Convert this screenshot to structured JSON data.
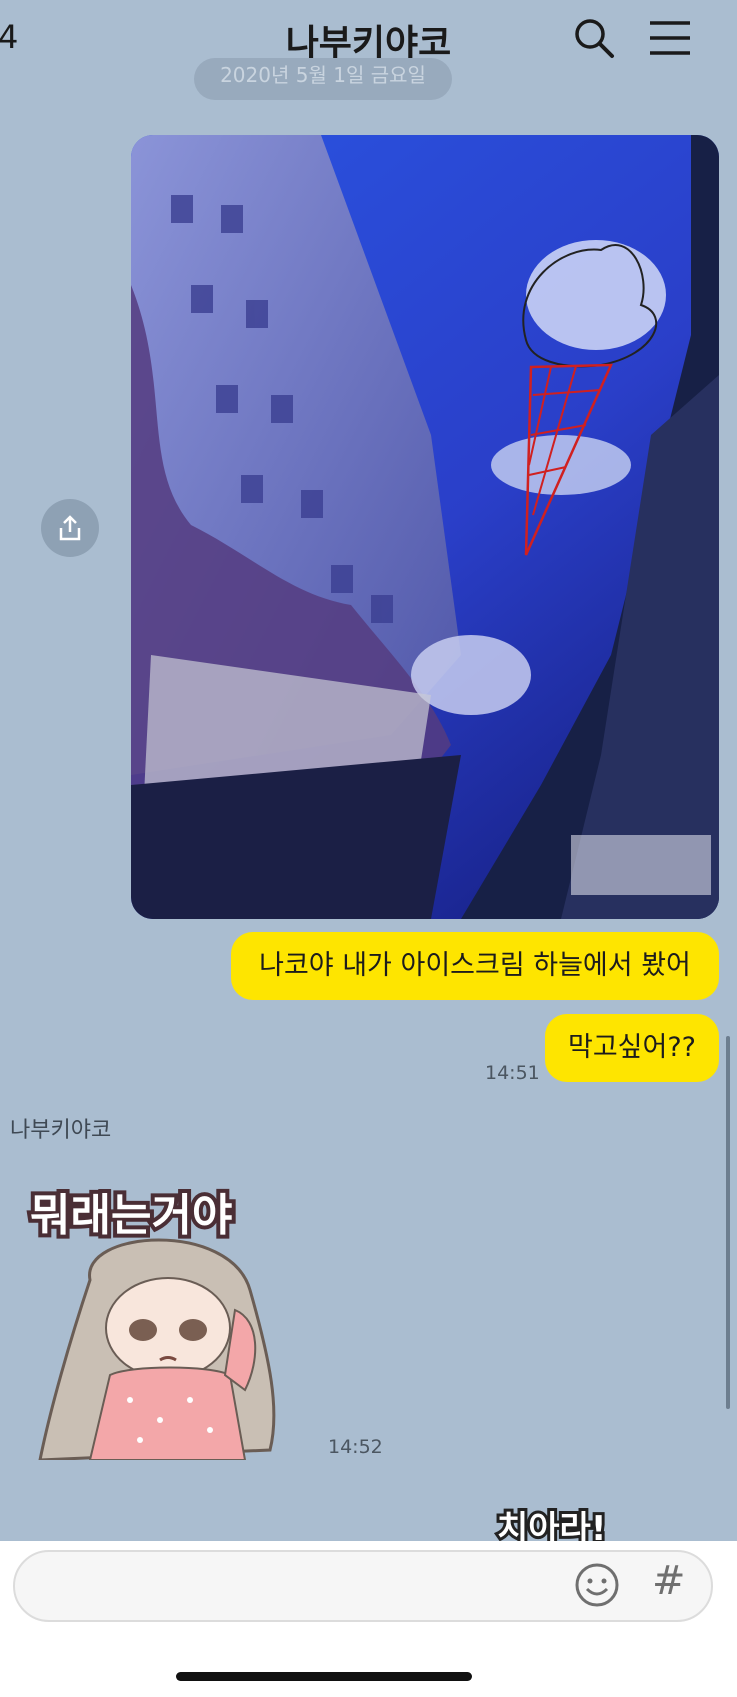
{
  "header": {
    "back_count": "4",
    "title": "나부키야코"
  },
  "date_pill": "2020년 5월 1일 금요일",
  "messages": {
    "bubble1": "나코야 내가 아이스크림 하늘에서 봤어",
    "bubble2": "막고싶어??",
    "time1": "14:51",
    "sender": "나부키야코",
    "sticker_text": "뭐래는거야",
    "time2": "14:52",
    "sticker2_text": "치아라!"
  },
  "input": {
    "placeholder": "",
    "hash": "#"
  },
  "colors": {
    "background": "#aabdd0",
    "bubble": "#fee500"
  }
}
